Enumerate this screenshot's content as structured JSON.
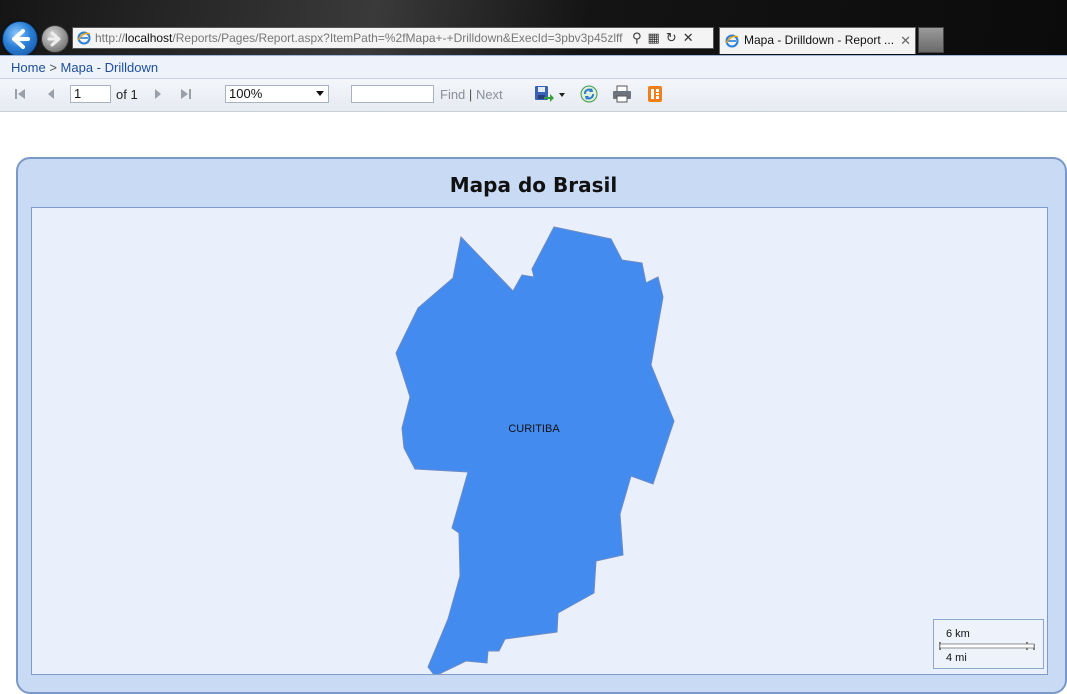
{
  "browser": {
    "address_url_prefix": "http://",
    "address_host": "localhost",
    "address_url_rest": "/Reports/Pages/Report.aspx?ItemPath=%2fMapa+-+Drilldown&ExecId=3pbv3p45zlff",
    "tab_title": "Mapa - Drilldown - Report ...",
    "tab_close": "✕"
  },
  "breadcrumb": {
    "home": "Home",
    "separator": ">",
    "current": "Mapa - Drilldown"
  },
  "toolbar": {
    "page_value": "1",
    "of_label": "of 1",
    "zoom_value": "100%",
    "find_label": "Find",
    "find_sep": "|",
    "next_label": "Next"
  },
  "report": {
    "title": "Mapa do Brasil",
    "region_label": "CURITIBA",
    "region_color": "#448bef",
    "scale_km": "6 km",
    "scale_mi": "4 mi"
  }
}
